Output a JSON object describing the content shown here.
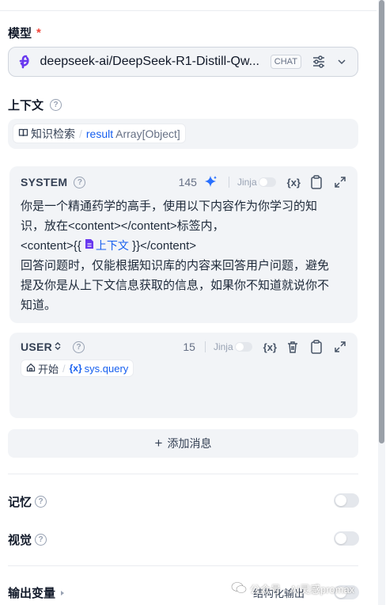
{
  "model": {
    "label": "模型",
    "required_mark": "*",
    "name": "deepseek-ai/DeepSeek-R1-Distill-Qw...",
    "mode_badge": "CHAT"
  },
  "context": {
    "label": "上下文",
    "node": "知识检索",
    "var": "result",
    "type": "Array[Object]"
  },
  "system": {
    "role": "SYSTEM",
    "count": "145",
    "jinja": "Jinja",
    "var_btn": "{x}",
    "lines": {
      "l1": "你是一个精通药学的高手，使用以下内容作为你学习的知",
      "l2": "识，放在<content></content>标签内，",
      "l3a": "<content>{{",
      "l3var": "上下文",
      "l3b": "}}</content>",
      "l4": "回答问题时，仅能根据知识库的内容来回答用户问题，避免",
      "l5": "提及你是从上下文信息获取的信息，如果你不知道就说你不",
      "l6": "知道。"
    }
  },
  "user": {
    "role": "USER",
    "count": "15",
    "jinja": "Jinja",
    "var_btn": "{x}",
    "node": "开始",
    "var": "sys.query"
  },
  "add_message": {
    "icon": "+",
    "label": "添加消息"
  },
  "memory": {
    "label": "记忆"
  },
  "vision": {
    "label": "视觉"
  },
  "output": {
    "label": "输出变量",
    "structured": "结构化输出"
  },
  "watermark": "公众号 · AI灵感promax",
  "colors": {
    "accent": "#155eef",
    "required": "#f04438",
    "logo": "#6938ef",
    "magic": "#2970ff"
  }
}
